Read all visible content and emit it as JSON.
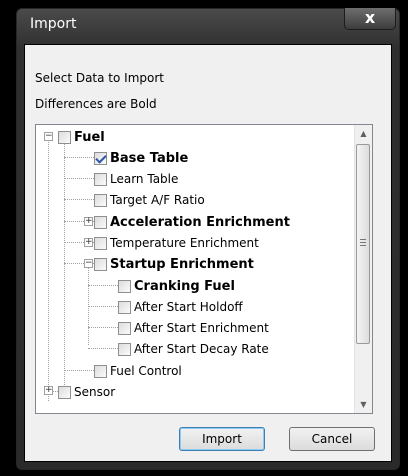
{
  "window": {
    "title": "Import",
    "close_glyph": "x"
  },
  "labels": {
    "select": "Select Data to Import",
    "differences": "Differences are Bold"
  },
  "tree": {
    "items": [
      {
        "label": "Fuel",
        "bold": true,
        "checked": false
      },
      {
        "label": "Base Table",
        "bold": true,
        "checked": true
      },
      {
        "label": "Learn Table",
        "bold": false,
        "checked": false
      },
      {
        "label": "Target A/F Ratio",
        "bold": false,
        "checked": false
      },
      {
        "label": "Acceleration Enrichment",
        "bold": true,
        "checked": false
      },
      {
        "label": "Temperature Enrichment",
        "bold": false,
        "checked": false
      },
      {
        "label": "Startup Enrichment",
        "bold": true,
        "checked": false
      },
      {
        "label": "Cranking Fuel",
        "bold": true,
        "checked": false
      },
      {
        "label": "After Start Holdoff",
        "bold": false,
        "checked": false
      },
      {
        "label": "After Start Enrichment",
        "bold": false,
        "checked": false
      },
      {
        "label": "After Start Decay Rate",
        "bold": false,
        "checked": false
      },
      {
        "label": "Fuel Control",
        "bold": false,
        "checked": false
      },
      {
        "label": "Sensor",
        "bold": false,
        "checked": false
      }
    ]
  },
  "buttons": {
    "import": "Import",
    "cancel": "Cancel"
  }
}
